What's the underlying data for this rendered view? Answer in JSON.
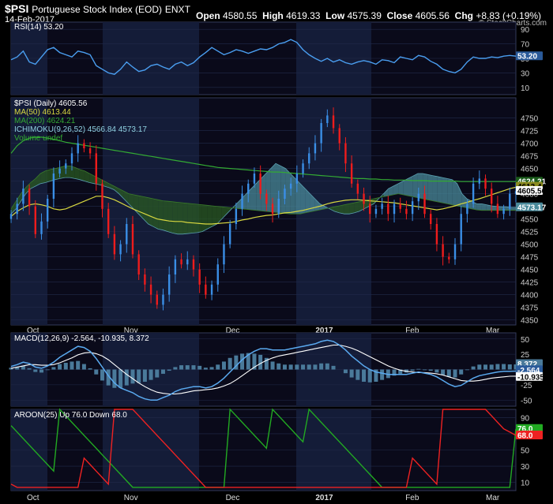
{
  "header": {
    "symbol": "$PSI",
    "name": "Portuguese Stock Index (EOD)",
    "exchange": "ENXT",
    "date": "14-Feb-2017",
    "open_label": "Open",
    "open": "4580.55",
    "high_label": "High",
    "high": "4619.33",
    "low_label": "Low",
    "low": "4575.39",
    "close_label": "Close",
    "close": "4605.56",
    "chg_label": "Chg",
    "chg": "+8.83 (+0.19%)",
    "brand": "© StockCharts.com"
  },
  "colors": {
    "background": "#000000",
    "panel": "#0a0a1a",
    "shade": "#141c38",
    "grid": "#222a4a",
    "up": "#3a8ee6",
    "down": "#ee1c1c",
    "rsi": "#4a9ef0",
    "ma50": "#d8d840",
    "ma200": "#33aa33",
    "cloud_green": "#2a5a22",
    "cloud_blue": "#4a8a9a",
    "macd": "#5aaaf0",
    "signal": "#ffffff",
    "hist": "#4a7a9a",
    "aroon_up": "#22aa22",
    "aroon_down": "#ee2222"
  },
  "chart_data": [
    {
      "type": "line",
      "title": "RSI(14) 53.20",
      "ylim": [
        0,
        100
      ],
      "yticks": [
        "90",
        "70",
        "50",
        "30",
        "10"
      ],
      "last_label": "53.20",
      "x": [
        0,
        2,
        4,
        6,
        8,
        10,
        12,
        14,
        16,
        18,
        20,
        22,
        24,
        26,
        28,
        30,
        32,
        34,
        36,
        38,
        40,
        42,
        44,
        46,
        48,
        50,
        52,
        54,
        56,
        58,
        60,
        62,
        64,
        66,
        68,
        70,
        72,
        74,
        76,
        78,
        80,
        82,
        84,
        86,
        88,
        90,
        92,
        94,
        96,
        98,
        100,
        102,
        104,
        106,
        108,
        110,
        112,
        114,
        116,
        118,
        120,
        122,
        124,
        126,
        128,
        130,
        132,
        134,
        136,
        138,
        140,
        142,
        144,
        146,
        148,
        150,
        152,
        154,
        156,
        158,
        160,
        162,
        164,
        166
      ],
      "values": [
        48,
        52,
        60,
        45,
        42,
        52,
        62,
        65,
        58,
        55,
        52,
        60,
        58,
        55,
        40,
        35,
        30,
        28,
        35,
        45,
        38,
        32,
        34,
        40,
        42,
        38,
        35,
        42,
        45,
        40,
        44,
        52,
        58,
        65,
        60,
        55,
        58,
        62,
        60,
        57,
        60,
        63,
        62,
        65,
        70,
        72,
        76,
        72,
        62,
        55,
        50,
        46,
        50,
        45,
        48,
        44,
        42,
        45,
        47,
        45,
        42,
        48,
        47,
        44,
        52,
        50,
        48,
        54,
        52,
        46,
        42,
        35,
        32,
        30,
        35,
        45,
        52,
        50,
        50,
        52,
        51,
        53,
        54,
        53
      ]
    },
    {
      "type": "line",
      "title": "$PSI (Daily) 4605.56",
      "legend": [
        "$PSI (Daily) 4605.56",
        "MA(50) 4613.44",
        "MA(200) 4624.21",
        "ICHIMOKU(9,26,52) 4566.84 4573.17",
        "Volume undef"
      ],
      "ylim": [
        4340,
        4790
      ],
      "yticks": [
        "4750",
        "4725",
        "4700",
        "4675",
        "4650",
        "4625",
        "4600",
        "4575",
        "4550",
        "4525",
        "4500",
        "4475",
        "4450",
        "4425",
        "4400",
        "4375",
        "4350"
      ],
      "last_labels": [
        "4624.21",
        "4613.44",
        "4605.56",
        "4573.17"
      ],
      "x": [
        0,
        2,
        4,
        6,
        8,
        10,
        12,
        14,
        16,
        18,
        20,
        22,
        24,
        26,
        28,
        30,
        32,
        34,
        36,
        38,
        40,
        42,
        44,
        46,
        48,
        50,
        52,
        54,
        56,
        58,
        60,
        62,
        64,
        66,
        68,
        70,
        72,
        74,
        76,
        78,
        80,
        82,
        84,
        86,
        88,
        90,
        92,
        94,
        96,
        98,
        100,
        102,
        104,
        106,
        108,
        110,
        112,
        114,
        116,
        118,
        120,
        122,
        124,
        126,
        128,
        130,
        132,
        134,
        136,
        138,
        140,
        142,
        144,
        146,
        148,
        150,
        152,
        154,
        156,
        158,
        160,
        162,
        164,
        166
      ],
      "close": [
        4560,
        4580,
        4610,
        4575,
        4520,
        4545,
        4590,
        4640,
        4650,
        4660,
        4680,
        4700,
        4690,
        4680,
        4620,
        4570,
        4520,
        4480,
        4500,
        4540,
        4480,
        4440,
        4420,
        4400,
        4380,
        4400,
        4440,
        4470,
        4460,
        4470,
        4450,
        4420,
        4400,
        4420,
        4460,
        4500,
        4540,
        4570,
        4600,
        4620,
        4640,
        4600,
        4580,
        4560,
        4590,
        4610,
        4620,
        4640,
        4660,
        4680,
        4700,
        4740,
        4755,
        4730,
        4700,
        4660,
        4620,
        4600,
        4580,
        4560,
        4570,
        4580,
        4560,
        4580,
        4570,
        4560,
        4585,
        4600,
        4560,
        4540,
        4500,
        4475,
        4470,
        4500,
        4560,
        4580,
        4620,
        4630,
        4610,
        4580,
        4560,
        4570,
        4600,
        4605
      ],
      "ma50": [
        4555,
        4565,
        4572,
        4578,
        4580,
        4578,
        4575,
        4570,
        4568,
        4570,
        4575,
        4580,
        4585,
        4590,
        4595,
        4595,
        4592,
        4588,
        4582,
        4576,
        4570,
        4565,
        4560,
        4555,
        4550,
        4548,
        4546,
        4545,
        4545,
        4543,
        4542,
        4541,
        4540,
        4540,
        4541,
        4542,
        4543,
        4545,
        4548,
        4550,
        4553,
        4555,
        4557,
        4558,
        4560,
        4562,
        4563,
        4565,
        4567,
        4570,
        4573,
        4576,
        4580,
        4583,
        4585,
        4587,
        4588,
        4588,
        4587,
        4586,
        4585,
        4584,
        4583,
        4582,
        4580,
        4578,
        4576,
        4574,
        4572,
        4570,
        4568,
        4570,
        4573,
        4576,
        4580,
        4583,
        4587,
        4590,
        4594,
        4598,
        4602,
        4606,
        4610,
        4613
      ],
      "ma200": [
        4680,
        4695,
        4705,
        4710,
        4712,
        4712,
        4710,
        4708,
        4705,
        4702,
        4700,
        4698,
        4696,
        4694,
        4692,
        4690,
        4688,
        4686,
        4684,
        4682,
        4680,
        4678,
        4676,
        4674,
        4672,
        4670,
        4668,
        4666,
        4664,
        4662,
        4660,
        4658,
        4656,
        4654,
        4652,
        4651,
        4650,
        4649,
        4648,
        4647,
        4646,
        4645,
        4644,
        4643,
        4643,
        4642,
        4641,
        4640,
        4639,
        4638,
        4637,
        4636,
        4635,
        4634,
        4633,
        4632,
        4631,
        4630,
        4630,
        4629,
        4629,
        4628,
        4628,
        4627,
        4627,
        4627,
        4626,
        4626,
        4626,
        4625,
        4625,
        4625,
        4625,
        4625,
        4624,
        4624,
        4624,
        4624,
        4624,
        4624,
        4624,
        4624,
        4624,
        4624
      ],
      "cloud_a": [
        4560,
        4570,
        4585,
        4600,
        4610,
        4615,
        4620,
        4622,
        4625,
        4628,
        4630,
        4632,
        4632,
        4630,
        4628,
        4625,
        4622,
        4620,
        4618,
        4615,
        4612,
        4608,
        4600,
        4590,
        4580,
        4570,
        4560,
        4550,
        4540,
        4535,
        4530,
        4528,
        4525,
        4522,
        4520,
        4520,
        4521,
        4522,
        4523,
        4525,
        4530,
        4535,
        4540,
        4550,
        4560,
        4570,
        4580,
        4590,
        4600,
        4610,
        4620,
        4630,
        4640,
        4650,
        4660,
        4655,
        4650,
        4640,
        4630,
        4620,
        4610,
        4600,
        4590,
        4580,
        4575,
        4570,
        4565,
        4562,
        4560,
        4560,
        4562,
        4565,
        4570,
        4575,
        4580,
        4590,
        4600,
        4610,
        4615,
        4620,
        4625,
        4630,
        4635,
        4640,
        4640,
        4638,
        4636,
        4634,
        4632,
        4630,
        4628,
        4620,
        4600,
        4590,
        4585,
        4580,
        4580,
        4578,
        4576,
        4575,
        4574,
        4574,
        4573,
        4573
      ],
      "cloud_b": [
        4570,
        4585,
        4600,
        4612,
        4622,
        4630,
        4640,
        4645,
        4648,
        4650,
        4652,
        4655,
        4655,
        4652,
        4648,
        4645,
        4640,
        4635,
        4630,
        4625,
        4620,
        4615,
        4610,
        4605,
        4600,
        4598,
        4596,
        4594,
        4592,
        4590,
        4588,
        4586,
        4585,
        4584,
        4583,
        4582,
        4581,
        4580,
        4579,
        4578,
        4577,
        4576,
        4575,
        4574,
        4573,
        4572,
        4571,
        4570,
        4569,
        4568,
        4567,
        4566,
        4565,
        4564,
        4563,
        4562,
        4561,
        4560,
        4560,
        4560,
        4562,
        4564,
        4566,
        4568,
        4570,
        4572,
        4574,
        4576,
        4578,
        4580,
        4582,
        4584,
        4586,
        4588,
        4590,
        4592,
        4594,
        4596,
        4598,
        4600,
        4598,
        4596,
        4594,
        4592,
        4590,
        4588,
        4586,
        4584,
        4582,
        4580,
        4578,
        4576,
        4574,
        4572,
        4570,
        4568,
        4567,
        4567,
        4567,
        4567,
        4567,
        4567,
        4567,
        4567
      ]
    },
    {
      "type": "line",
      "title": "MACD(12,26,9) -2.564, -10.935, 8.372",
      "ylim": [
        -60,
        60
      ],
      "yticks": [
        "50",
        "25",
        "0",
        "-25",
        "-50"
      ],
      "last_labels": [
        "8.372",
        "-2.564",
        "-10.935"
      ],
      "x": [
        0,
        2,
        4,
        6,
        8,
        10,
        12,
        14,
        16,
        18,
        20,
        22,
        24,
        26,
        28,
        30,
        32,
        34,
        36,
        38,
        40,
        42,
        44,
        46,
        48,
        50,
        52,
        54,
        56,
        58,
        60,
        62,
        64,
        66,
        68,
        70,
        72,
        74,
        76,
        78,
        80,
        82,
        84,
        86,
        88,
        90,
        92,
        94,
        96,
        98,
        100,
        102,
        104,
        106,
        108,
        110,
        112,
        114,
        116,
        118,
        120,
        122,
        124,
        126,
        128,
        130,
        132,
        134,
        136,
        138,
        140,
        142,
        144,
        146,
        148,
        150,
        152,
        154,
        156,
        158,
        160,
        162,
        164,
        166
      ],
      "macd": [
        5,
        8,
        12,
        10,
        4,
        2,
        6,
        12,
        20,
        26,
        32,
        38,
        36,
        30,
        18,
        4,
        -10,
        -22,
        -30,
        -34,
        -38,
        -44,
        -48,
        -50,
        -50,
        -46,
        -42,
        -36,
        -32,
        -30,
        -28,
        -28,
        -30,
        -28,
        -22,
        -14,
        -4,
        6,
        16,
        24,
        30,
        34,
        34,
        32,
        32,
        32,
        34,
        36,
        38,
        40,
        42,
        46,
        48,
        46,
        40,
        32,
        22,
        14,
        6,
        0,
        -4,
        -6,
        -8,
        -8,
        -8,
        -8,
        -6,
        -4,
        -6,
        -8,
        -12,
        -18,
        -24,
        -28,
        -26,
        -20,
        -14,
        -10,
        -8,
        -6,
        -4,
        -3,
        -3,
        -2.6
      ],
      "signal": [
        2,
        4,
        6,
        8,
        8,
        7,
        7,
        8,
        11,
        15,
        19,
        24,
        27,
        28,
        26,
        22,
        16,
        8,
        0,
        -8,
        -15,
        -22,
        -28,
        -33,
        -37,
        -39,
        -40,
        -40,
        -39,
        -37,
        -35,
        -34,
        -33,
        -32,
        -30,
        -27,
        -23,
        -17,
        -10,
        -3,
        4,
        10,
        15,
        19,
        22,
        24,
        26,
        28,
        30,
        32,
        34,
        36,
        38,
        40,
        40,
        38,
        35,
        31,
        26,
        21,
        16,
        11,
        6,
        2,
        -1,
        -3,
        -4,
        -5,
        -5,
        -6,
        -7,
        -9,
        -12,
        -15,
        -18,
        -19,
        -19,
        -18,
        -16,
        -14,
        -13,
        -12,
        -11,
        -10.9
      ],
      "hist": [
        3,
        4,
        6,
        2,
        -4,
        -5,
        -1,
        4,
        9,
        11,
        13,
        14,
        9,
        2,
        -8,
        -18,
        -26,
        -30,
        -30,
        -26,
        -23,
        -22,
        -20,
        -17,
        -13,
        -7,
        -2,
        4,
        7,
        7,
        7,
        6,
        3,
        4,
        8,
        13,
        19,
        23,
        26,
        27,
        26,
        24,
        19,
        13,
        10,
        8,
        8,
        8,
        8,
        8,
        8,
        10,
        10,
        6,
        0,
        -6,
        -13,
        -17,
        -20,
        -21,
        -20,
        -17,
        -14,
        -10,
        -7,
        -5,
        -2,
        1,
        -1,
        -2,
        -5,
        -9,
        -12,
        -13,
        -8,
        -1,
        5,
        8,
        8,
        8,
        9,
        9,
        8.4,
        8.372
      ]
    },
    {
      "type": "line",
      "title": "AROON(25) Up 76.0 Down 68.0",
      "ylim": [
        0,
        100
      ],
      "yticks": [
        "90",
        "70",
        "50",
        "30",
        "10"
      ],
      "last_labels": [
        "76.0",
        "68.0"
      ],
      "x": [
        0,
        2,
        4,
        6,
        8,
        10,
        12,
        14,
        16,
        18,
        20,
        22,
        24,
        26,
        28,
        30,
        32,
        34,
        36,
        38,
        40,
        42,
        44,
        46,
        48,
        50,
        52,
        54,
        56,
        58,
        60,
        62,
        64,
        66,
        68,
        70,
        72,
        74,
        76,
        78,
        80,
        82,
        84,
        86,
        88,
        90,
        92,
        94,
        96,
        98,
        100,
        102,
        104,
        106,
        108,
        110,
        112,
        114,
        116,
        118,
        120,
        122,
        124,
        126,
        128,
        130,
        132,
        134,
        136,
        138,
        140,
        142,
        144,
        146,
        148,
        150,
        152,
        154,
        156,
        158,
        160,
        162,
        164,
        166
      ],
      "up": [
        80,
        72,
        64,
        56,
        48,
        40,
        32,
        24,
        100,
        92,
        84,
        76,
        68,
        60,
        52,
        44,
        36,
        28,
        20,
        12,
        4,
        4,
        4,
        4,
        4,
        4,
        4,
        4,
        4,
        4,
        4,
        4,
        4,
        4,
        4,
        4,
        100,
        92,
        84,
        76,
        68,
        60,
        52,
        100,
        92,
        84,
        76,
        68,
        60,
        100,
        92,
        84,
        76,
        68,
        60,
        52,
        44,
        36,
        28,
        20,
        12,
        4,
        4,
        4,
        4,
        4,
        4,
        4,
        4,
        4,
        4,
        4,
        4,
        4,
        4,
        4,
        4,
        4,
        4,
        4,
        4,
        4,
        4,
        76
      ],
      "down": [
        8,
        4,
        4,
        4,
        4,
        4,
        4,
        4,
        4,
        4,
        4,
        4,
        40,
        32,
        24,
        16,
        8,
        100,
        100,
        100,
        100,
        92,
        84,
        76,
        68,
        60,
        52,
        44,
        36,
        28,
        20,
        12,
        4,
        4,
        4,
        4,
        4,
        4,
        4,
        4,
        4,
        4,
        4,
        4,
        4,
        4,
        4,
        4,
        4,
        4,
        4,
        4,
        4,
        4,
        4,
        4,
        4,
        4,
        4,
        4,
        4,
        4,
        4,
        4,
        4,
        4,
        40,
        32,
        24,
        16,
        8,
        100,
        100,
        100,
        100,
        100,
        100,
        100,
        100,
        92,
        84,
        76,
        72,
        68
      ]
    }
  ],
  "x_axis_labels": [
    "Oct",
    "Nov",
    "Dec",
    "2017",
    "Feb",
    "Mar"
  ]
}
